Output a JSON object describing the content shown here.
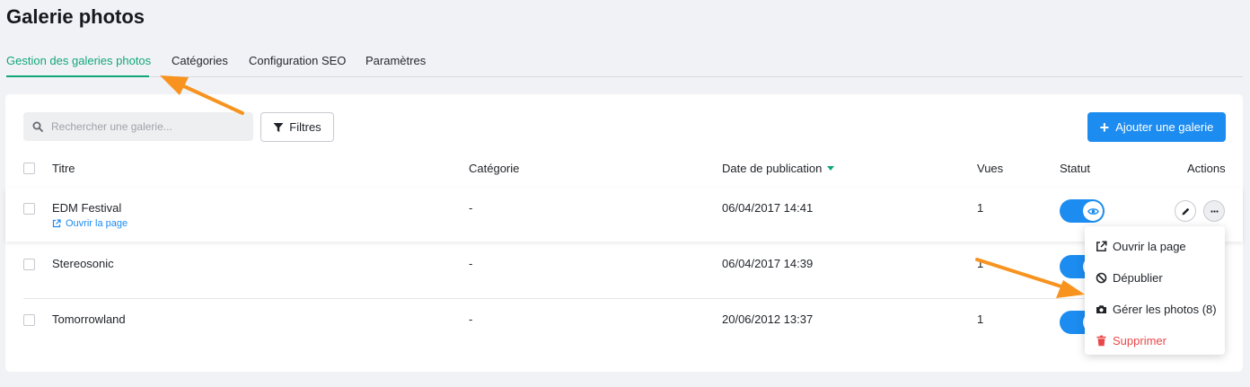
{
  "page": {
    "title": "Galerie photos"
  },
  "tabs": [
    {
      "label": "Gestion des galeries photos",
      "active": true
    },
    {
      "label": "Catégories"
    },
    {
      "label": "Configuration SEO"
    },
    {
      "label": "Paramètres"
    }
  ],
  "toolbar": {
    "search_placeholder": "Rechercher une galerie...",
    "filter_label": "Filtres",
    "add_label": "Ajouter une galerie"
  },
  "table": {
    "columns": {
      "title": "Titre",
      "category": "Catégorie",
      "date": "Date de publication",
      "views": "Vues",
      "status": "Statut",
      "actions": "Actions"
    },
    "sort_column": "Date de publication",
    "sort_direction": "desc",
    "rows": [
      {
        "title": "EDM Festival",
        "link": "Ouvrir la page",
        "category": "-",
        "date": "06/04/2017 14:41",
        "views": "1",
        "published": true
      },
      {
        "title": "Stereosonic",
        "category": "-",
        "date": "06/04/2017 14:39",
        "views": "1",
        "published": true
      },
      {
        "title": "Tomorrowland",
        "category": "-",
        "date": "20/06/2012 13:37",
        "views": "1",
        "published": true
      }
    ]
  },
  "actions_menu": {
    "items": [
      {
        "label": "Ouvrir la page",
        "icon": "external-link-icon"
      },
      {
        "label": "Dépublier",
        "icon": "ban-icon"
      },
      {
        "label": "Gérer les photos (8)",
        "icon": "camera-icon"
      },
      {
        "label": "Supprimer",
        "icon": "trash-icon",
        "danger": true
      }
    ]
  },
  "colors": {
    "accent_green": "#11a67a",
    "primary_blue": "#1c8cf0",
    "danger_red": "#e9484a",
    "annotation_orange": "#f7931e"
  }
}
